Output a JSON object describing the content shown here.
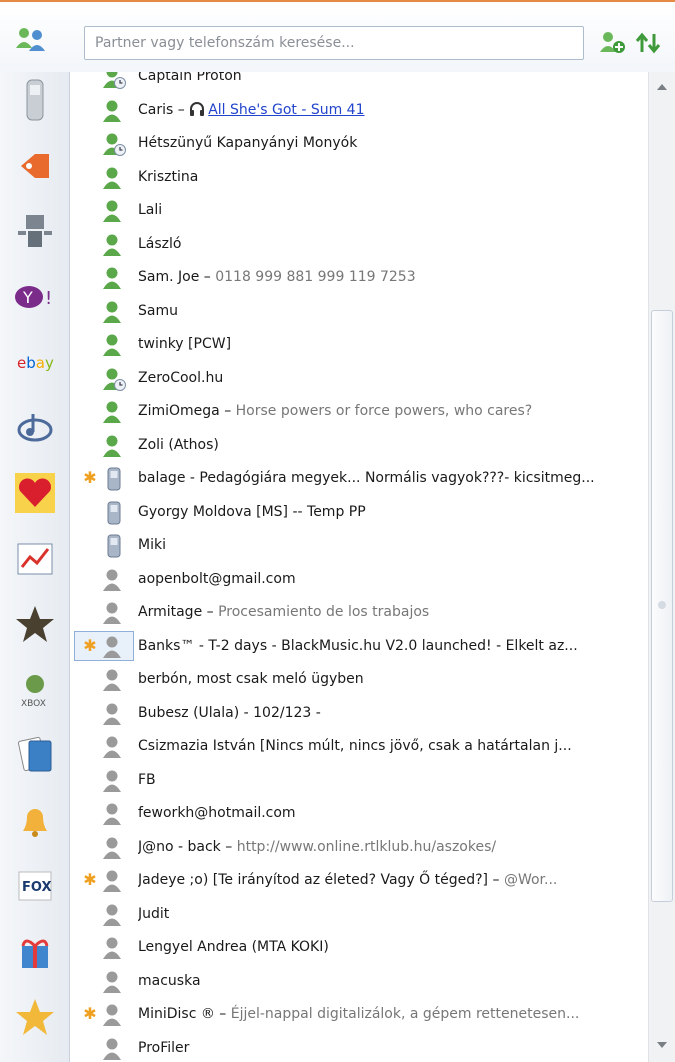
{
  "search": {
    "placeholder": "Partner vagy telefonszám keresése..."
  },
  "colors": {
    "accent": "#e58a44",
    "online": "#5aa84a",
    "offline": "#9a9a9a",
    "status_text": "#777777",
    "link": "#2244cc"
  },
  "sidebar": {
    "items": [
      {
        "icon": "phone-icon"
      },
      {
        "icon": "shop-tag-icon"
      },
      {
        "icon": "robot-icon"
      },
      {
        "icon": "yahoo-icon"
      },
      {
        "icon": "ebay-icon"
      },
      {
        "icon": "music-icon"
      },
      {
        "icon": "heart-icon"
      },
      {
        "icon": "chart-icon"
      },
      {
        "icon": "star-icon"
      },
      {
        "icon": "xbox-icon"
      },
      {
        "icon": "cards-icon"
      },
      {
        "icon": "bell-icon"
      },
      {
        "icon": "fox-icon"
      },
      {
        "icon": "gift-icon"
      },
      {
        "icon": "favorite-star-icon"
      }
    ]
  },
  "contacts": [
    {
      "name": "Captain Proton",
      "sep": "",
      "status": "",
      "link": "",
      "icon": "online-away",
      "star": false,
      "selected": false,
      "partial": true
    },
    {
      "name": "Caris",
      "sep": " – ",
      "status": "",
      "link": "All She's Got - Sum 41",
      "icon": "online",
      "star": false,
      "selected": false
    },
    {
      "name": "Hétszünyű Kapanyányi Monyók",
      "sep": "",
      "status": "",
      "link": "",
      "icon": "online-away",
      "star": false,
      "selected": false
    },
    {
      "name": "Krisztina",
      "sep": "",
      "status": "",
      "link": "",
      "icon": "online",
      "star": false,
      "selected": false
    },
    {
      "name": "Lali",
      "sep": "",
      "status": "",
      "link": "",
      "icon": "online",
      "star": false,
      "selected": false
    },
    {
      "name": "László",
      "sep": "",
      "status": "",
      "link": "",
      "icon": "online",
      "star": false,
      "selected": false
    },
    {
      "name": "Sam. Joe",
      "sep": " – ",
      "status": "0118 999 881 999 119 7253",
      "link": "",
      "icon": "online",
      "star": false,
      "selected": false
    },
    {
      "name": "Samu",
      "sep": "",
      "status": "",
      "link": "",
      "icon": "online",
      "star": false,
      "selected": false
    },
    {
      "name": "twinky [PCW]",
      "sep": "",
      "status": "",
      "link": "",
      "icon": "online",
      "star": false,
      "selected": false
    },
    {
      "name": "ZeroCool.hu",
      "sep": "",
      "status": "",
      "link": "",
      "icon": "online-away",
      "star": false,
      "selected": false
    },
    {
      "name": "ZimiOmega",
      "sep": " – ",
      "status": "Horse powers or force powers, who cares?",
      "link": "",
      "icon": "online",
      "star": false,
      "selected": false
    },
    {
      "name": "Zoli (Athos)",
      "sep": "",
      "status": "",
      "link": "",
      "icon": "online",
      "star": false,
      "selected": false
    },
    {
      "name": "balage - Pedagógiára megyek... Normális vagyok???- kicsitmeg...",
      "sep": "",
      "status": "",
      "link": "",
      "icon": "mobile",
      "star": true,
      "selected": false
    },
    {
      "name": "Gyorgy Moldova [MS] -- Temp PP",
      "sep": "",
      "status": "",
      "link": "",
      "icon": "mobile",
      "star": false,
      "selected": false
    },
    {
      "name": "Miki",
      "sep": "",
      "status": "",
      "link": "",
      "icon": "mobile",
      "star": false,
      "selected": false
    },
    {
      "name": "aopenbolt@gmail.com",
      "sep": "",
      "status": "",
      "link": "",
      "icon": "offline",
      "star": false,
      "selected": false
    },
    {
      "name": "Armitage",
      "sep": " – ",
      "status": "Procesamiento de los trabajos",
      "link": "",
      "icon": "offline",
      "star": false,
      "selected": false
    },
    {
      "name": "Banks™ - T-2 days - BlackMusic.hu V2.0 launched! - Elkelt az...",
      "sep": "",
      "status": "",
      "link": "",
      "icon": "offline",
      "star": true,
      "selected": true
    },
    {
      "name": "berbón, most csak meló ügyben",
      "sep": "",
      "status": "",
      "link": "",
      "icon": "offline",
      "star": false,
      "selected": false
    },
    {
      "name": "Bubesz  (Ulala) - 102/123 -",
      "sep": "",
      "status": "",
      "link": "",
      "icon": "offline",
      "star": false,
      "selected": false
    },
    {
      "name": "Csizmazia István [Nincs múlt, nincs jövő, csak a határtalan j...",
      "sep": "",
      "status": "",
      "link": "",
      "icon": "offline",
      "star": false,
      "selected": false
    },
    {
      "name": "FB",
      "sep": "",
      "status": "",
      "link": "",
      "icon": "offline",
      "star": false,
      "selected": false
    },
    {
      "name": "feworkh@hotmail.com",
      "sep": "",
      "status": "",
      "link": "",
      "icon": "offline",
      "star": false,
      "selected": false
    },
    {
      "name": "J@no - back",
      "sep": " – ",
      "status": "http://www.online.rtlklub.hu/aszokes/",
      "link": "",
      "icon": "offline",
      "star": false,
      "selected": false
    },
    {
      "name": "Jadeye ;o) [Te irányítod az életed? Vagy Ő téged?]",
      "sep": " – ",
      "status": "@Wor...",
      "link": "",
      "icon": "offline",
      "star": true,
      "selected": false
    },
    {
      "name": "Judit",
      "sep": "",
      "status": "",
      "link": "",
      "icon": "offline",
      "star": false,
      "selected": false
    },
    {
      "name": "Lengyel Andrea (MTA KOKI)",
      "sep": "",
      "status": "",
      "link": "",
      "icon": "offline",
      "star": false,
      "selected": false
    },
    {
      "name": "macuska",
      "sep": "",
      "status": "",
      "link": "",
      "icon": "offline",
      "star": false,
      "selected": false
    },
    {
      "name": "MiniDisc ®",
      "sep": " – ",
      "status": "Éjjel-nappal digitalizálok, a gépem rettenetesen...",
      "link": "",
      "icon": "offline",
      "star": true,
      "selected": false
    },
    {
      "name": "ProFiler",
      "sep": "",
      "status": "",
      "link": "",
      "icon": "offline",
      "star": false,
      "selected": false
    }
  ]
}
